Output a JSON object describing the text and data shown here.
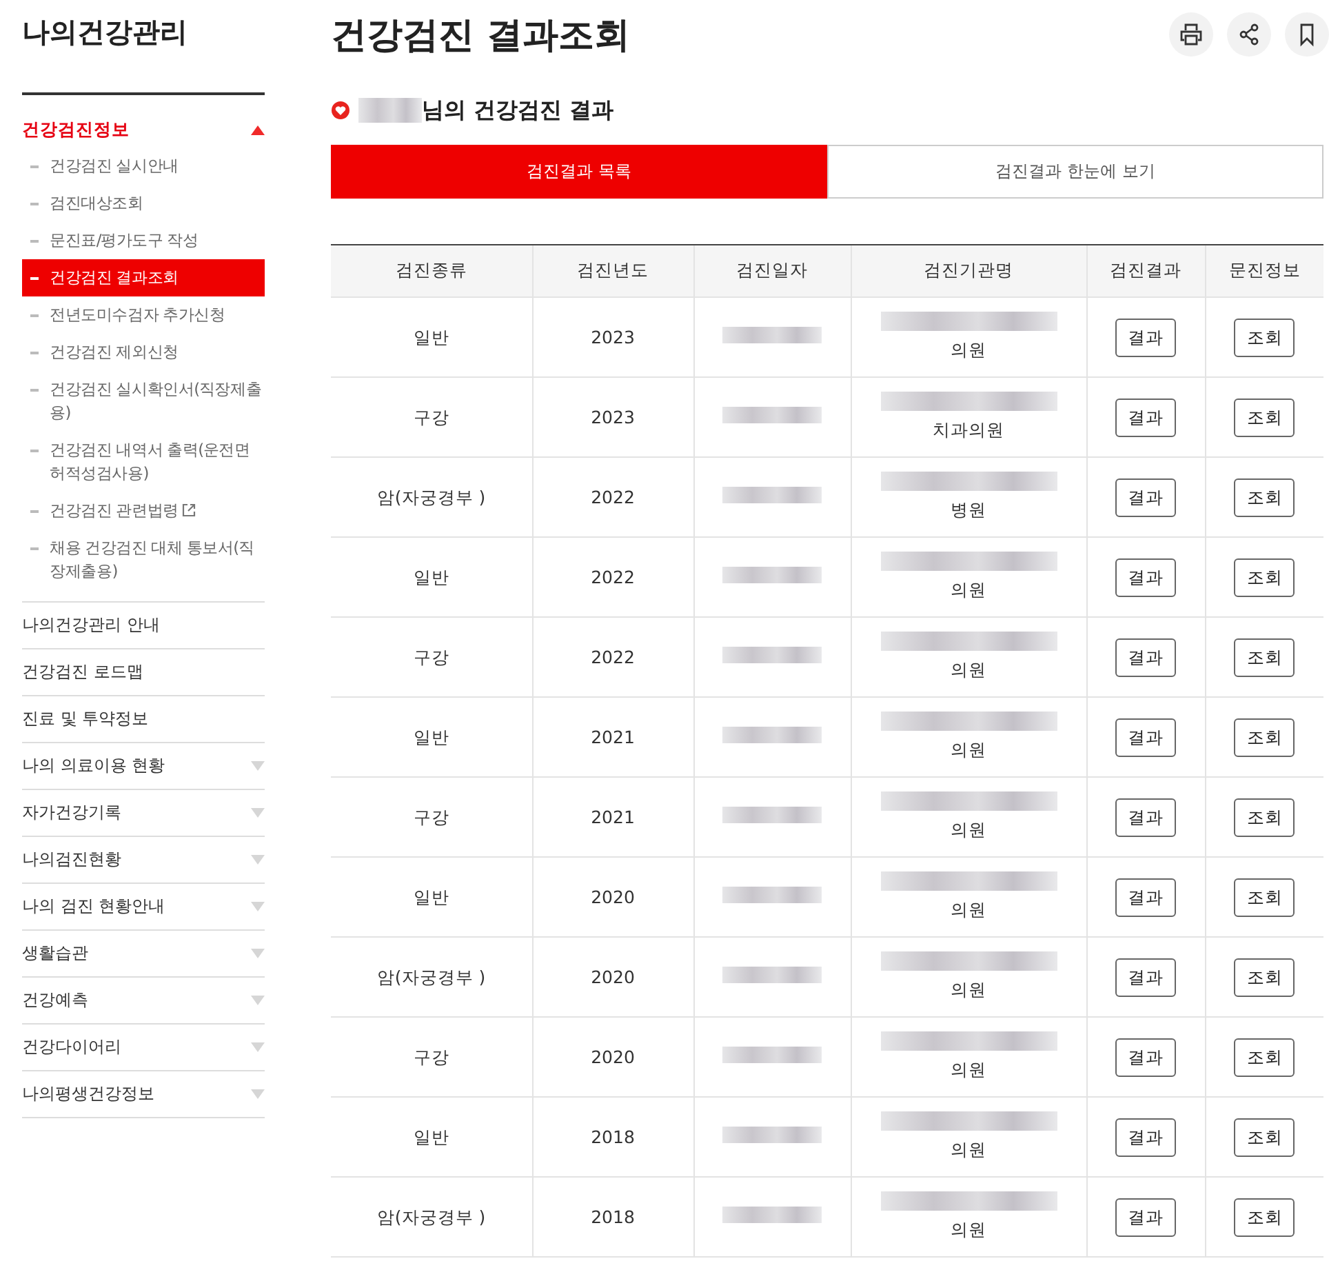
{
  "sidebar": {
    "title": "나의건강관리",
    "section": {
      "label": "건강검진정보",
      "expanded": true,
      "items": [
        {
          "label": "건강검진 실시안내",
          "selected": false,
          "external": false
        },
        {
          "label": "검진대상조회",
          "selected": false,
          "external": false
        },
        {
          "label": "문진표/평가도구 작성",
          "selected": false,
          "external": false
        },
        {
          "label": "건강검진 결과조회",
          "selected": true,
          "external": false
        },
        {
          "label": "전년도미수검자 추가신청",
          "selected": false,
          "external": false
        },
        {
          "label": "건강검진 제외신청",
          "selected": false,
          "external": false
        },
        {
          "label": "건강검진 실시확인서(직장제출용)",
          "selected": false,
          "external": false
        },
        {
          "label": "건강검진 내역서 출력(운전면허적성검사용)",
          "selected": false,
          "external": false
        },
        {
          "label": "건강검진 관련법령",
          "selected": false,
          "external": true
        },
        {
          "label": "채용 건강검진 대체 통보서(직장제출용)",
          "selected": false,
          "external": false
        }
      ]
    },
    "menu": [
      {
        "label": "나의건강관리 안내",
        "has_submenu": false
      },
      {
        "label": "건강검진 로드맵",
        "has_submenu": false
      },
      {
        "label": "진료 및 투약정보",
        "has_submenu": false
      },
      {
        "label": "나의 의료이용 현황",
        "has_submenu": true
      },
      {
        "label": "자가건강기록",
        "has_submenu": true
      },
      {
        "label": "나의검진현황",
        "has_submenu": true
      },
      {
        "label": "나의 검진 현황안내",
        "has_submenu": true
      },
      {
        "label": "생활습관",
        "has_submenu": true
      },
      {
        "label": "건강예측",
        "has_submenu": true
      },
      {
        "label": "건강다이어리",
        "has_submenu": true
      },
      {
        "label": "나의평생건강정보",
        "has_submenu": true
      }
    ]
  },
  "page": {
    "title": "건강검진 결과조회",
    "subtitle": "님의 건강검진 결과",
    "tabs": [
      {
        "label": "검진결과 목록",
        "selected": true
      },
      {
        "label": "검진결과 한눈에 보기",
        "selected": false
      }
    ],
    "table": {
      "columns": [
        "검진종류",
        "검진년도",
        "검진일자",
        "검진기관명",
        "검진결과",
        "문진정보"
      ],
      "rows": [
        {
          "type": "일반",
          "year": "2023",
          "institution_suffix": "의원",
          "result_button": "결과",
          "survey_button": "조회"
        },
        {
          "type": "구강",
          "year": "2023",
          "institution_suffix": "치과의원",
          "result_button": "결과",
          "survey_button": "조회"
        },
        {
          "type": "암(자궁경부 )",
          "year": "2022",
          "institution_suffix": "병원",
          "result_button": "결과",
          "survey_button": "조회"
        },
        {
          "type": "일반",
          "year": "2022",
          "institution_suffix": "의원",
          "result_button": "결과",
          "survey_button": "조회"
        },
        {
          "type": "구강",
          "year": "2022",
          "institution_suffix": "의원",
          "result_button": "결과",
          "survey_button": "조회"
        },
        {
          "type": "일반",
          "year": "2021",
          "institution_suffix": "의원",
          "result_button": "결과",
          "survey_button": "조회"
        },
        {
          "type": "구강",
          "year": "2021",
          "institution_suffix": "의원",
          "result_button": "결과",
          "survey_button": "조회"
        },
        {
          "type": "일반",
          "year": "2020",
          "institution_suffix": "의원",
          "result_button": "결과",
          "survey_button": "조회"
        },
        {
          "type": "암(자궁경부 )",
          "year": "2020",
          "institution_suffix": "의원",
          "result_button": "결과",
          "survey_button": "조회"
        },
        {
          "type": "구강",
          "year": "2020",
          "institution_suffix": "의원",
          "result_button": "결과",
          "survey_button": "조회"
        },
        {
          "type": "일반",
          "year": "2018",
          "institution_suffix": "의원",
          "result_button": "결과",
          "survey_button": "조회"
        },
        {
          "type": "암(자궁경부 )",
          "year": "2018",
          "institution_suffix": "의원",
          "result_button": "결과",
          "survey_button": "조회"
        }
      ]
    }
  }
}
